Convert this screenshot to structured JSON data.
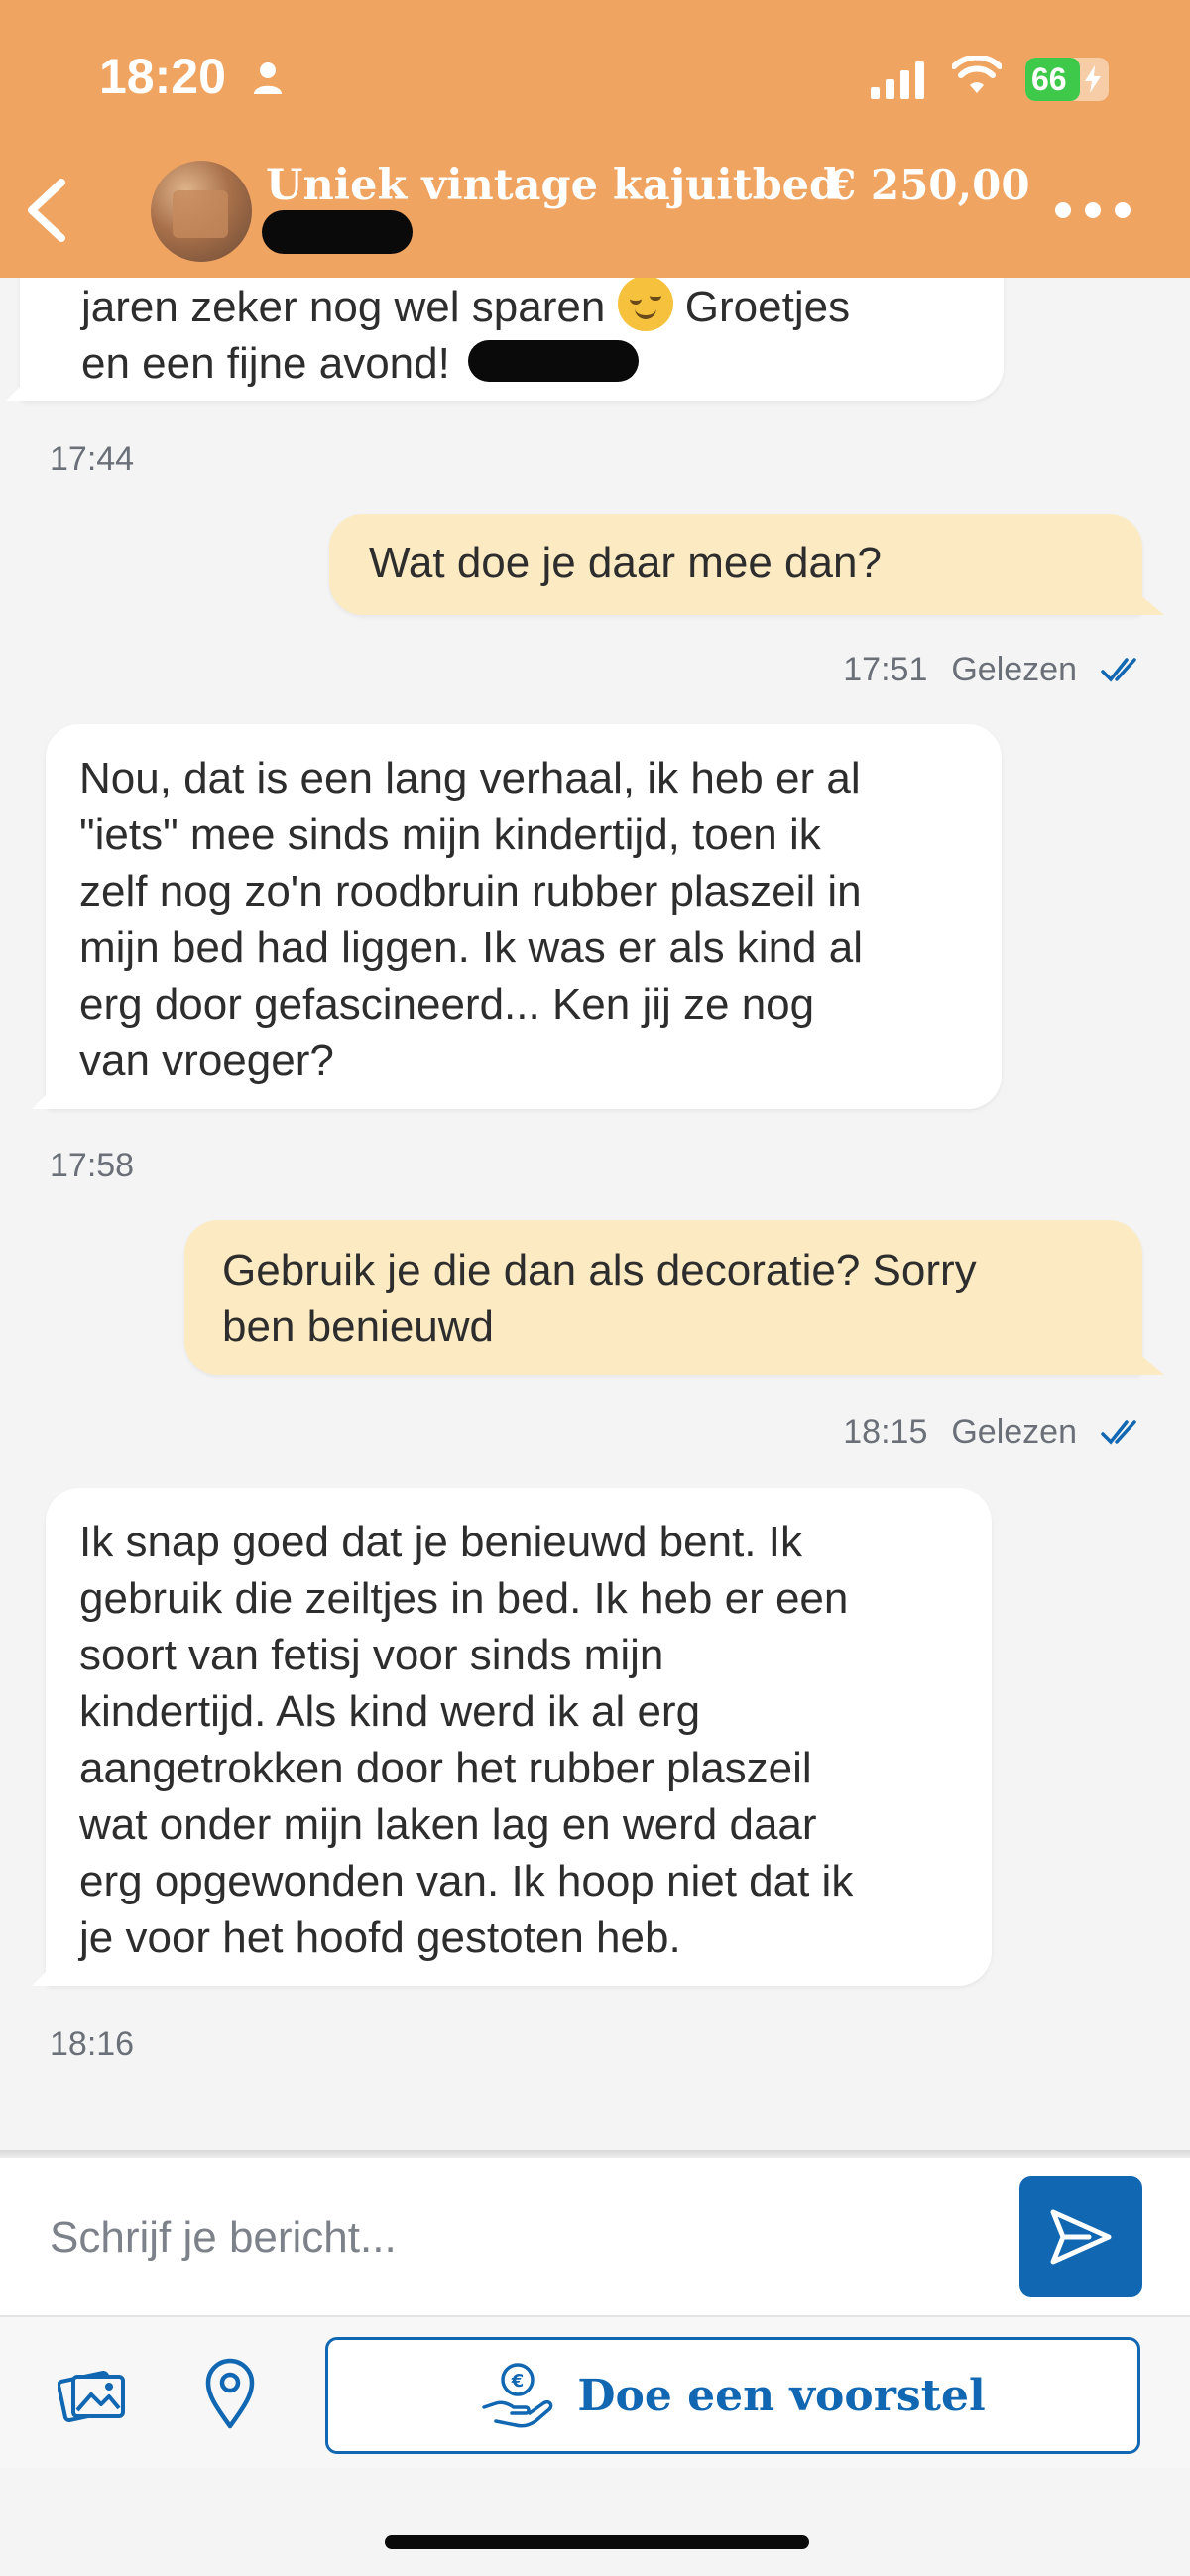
{
  "status_bar": {
    "time": "18:20",
    "battery": "66",
    "battery_level": 0.66
  },
  "header": {
    "title": "Uniek vintage kajuitbed",
    "price": "€ 250,00"
  },
  "messages": [
    {
      "direction": "in",
      "lines": [
        "jaren zeker nog wel sparen",
        "en een fijne avond!"
      ],
      "emoji_after_line1": "☺️",
      "trailing_text_line1": "Groetjes",
      "time": "17:44"
    },
    {
      "direction": "out",
      "lines": [
        "Wat doe je daar mee dan?"
      ],
      "time": "17:51",
      "status": "Gelezen"
    },
    {
      "direction": "in",
      "lines": [
        "Nou, dat is een lang verhaal, ik heb er al",
        "\"iets\" mee sinds mijn kindertijd, toen ik",
        "zelf nog zo'n roodbruin rubber plaszeil in",
        "mijn bed had liggen. Ik was er als kind al",
        "erg door gefascineerd... Ken jij ze nog",
        "van vroeger?"
      ],
      "time": "17:58"
    },
    {
      "direction": "out",
      "lines": [
        "Gebruik je die dan als decoratie? Sorry",
        "ben benieuwd"
      ],
      "time": "18:15",
      "status": "Gelezen"
    },
    {
      "direction": "in",
      "lines": [
        "Ik snap goed dat je benieuwd bent. Ik",
        "gebruik die zeiltjes in bed. Ik heb er een",
        "soort van fetisj voor sinds mijn",
        "kindertijd. Als kind werd ik al erg",
        "aangetrokken door het rubber plaszeil",
        "wat onder mijn laken lag en werd daar",
        "erg opgewonden van. Ik hoop niet dat ik",
        "je voor het hoofd gestoten heb."
      ],
      "time": "18:16"
    }
  ],
  "composer": {
    "placeholder": "Schrijf je bericht..."
  },
  "toolbar": {
    "offer_label": "Doe een voorstel"
  },
  "colors": {
    "header": "#f0a461",
    "accent": "#1167b1",
    "outgoing_bubble": "#fcebc2",
    "read_check": "#1167b1"
  },
  "icons": [
    "back-icon",
    "more-icon",
    "send-icon",
    "gallery-icon",
    "location-icon",
    "hand-coin-icon",
    "double-check-icon"
  ]
}
